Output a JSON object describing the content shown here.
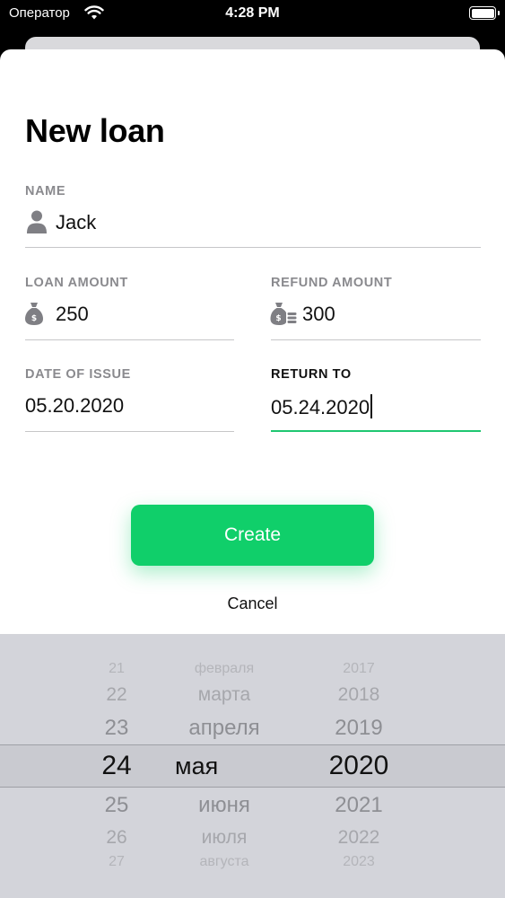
{
  "status_bar": {
    "carrier": "Оператор",
    "time": "4:28 PM"
  },
  "form": {
    "title": "New loan",
    "name": {
      "label": "NAME",
      "value": "Jack"
    },
    "loan_amount": {
      "label": "LOAN AMOUNT",
      "value": "250"
    },
    "refund_amount": {
      "label": "REFUND AMOUNT",
      "value": "300"
    },
    "date_of_issue": {
      "label": "DATE OF ISSUE",
      "value": "05.20.2020"
    },
    "return_to": {
      "label": "RETURN TO",
      "value": "05.24.2020"
    }
  },
  "actions": {
    "create_label": "Create",
    "cancel_label": "Cancel"
  },
  "colors": {
    "accent": "#10cf6a",
    "active_underline": "#1fc771",
    "label_gray": "#8a8a8e"
  },
  "picker": {
    "days": [
      "21",
      "22",
      "23",
      "24",
      "25",
      "26",
      "27"
    ],
    "months": [
      "февраля",
      "марта",
      "апреля",
      "мая",
      "июня",
      "июля",
      "августа"
    ],
    "years": [
      "2017",
      "2018",
      "2019",
      "2020",
      "2021",
      "2022",
      "2023"
    ],
    "selected_day": "24",
    "selected_month": "мая",
    "selected_year": "2020"
  }
}
